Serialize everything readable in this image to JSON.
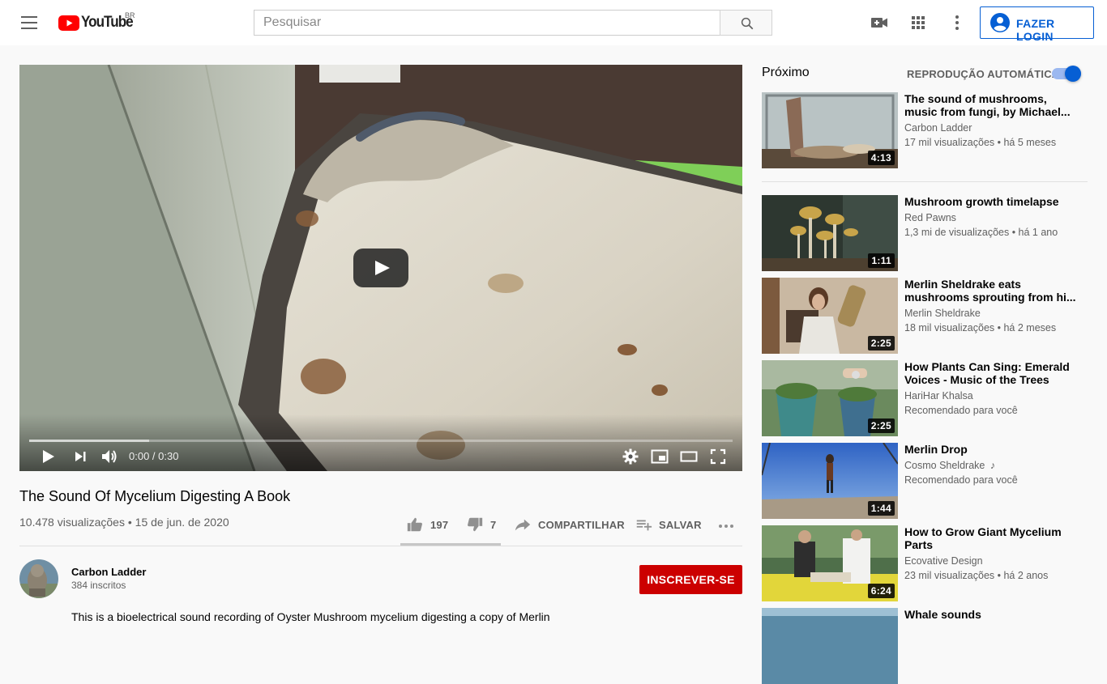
{
  "header": {
    "logo_text": "YouTube",
    "country": "BR",
    "search_placeholder": "Pesquisar",
    "login_label": "FAZER LOGIN",
    "colors": {
      "brand_red": "#ff0000",
      "accent_blue": "#065fd4"
    }
  },
  "player": {
    "time": "0:00 / 0:30",
    "progress_fraction": 0,
    "buffered_fraction": 0.17
  },
  "video": {
    "title": "The Sound Of Mycelium Digesting A Book",
    "views_date": "10.478 visualizações • 15 de jun. de 2020",
    "likes": "197",
    "dislikes": "7",
    "share_label": "COMPARTILHAR",
    "save_label": "SALVAR",
    "description_start": "This is a bioelectrical sound recording of Oyster Mushroom mycelium digesting a copy of Merlin"
  },
  "channel": {
    "name": "Carbon Ladder",
    "subscribers": "384 inscritos",
    "subscribe_label": "INSCREVER-SE"
  },
  "sidebar": {
    "next_label": "Próximo",
    "autoplay_label": "REPRODUÇÃO AUTOMÁTICA",
    "autoplay_on": true,
    "items": [
      {
        "title_line1": "The sound of mushrooms,",
        "title_line2": "music from fungi, by Michael...",
        "channel": "Carbon Ladder",
        "meta": "17 mil visualizações • há 5 meses",
        "duration": "4:13"
      },
      {
        "title_line1": "Mushroom growth timelapse",
        "title_line2": "",
        "channel": "Red Pawns",
        "meta": "1,3 mi de visualizações • há 1 ano",
        "duration": "1:11"
      },
      {
        "title_line1": "Merlin Sheldrake eats",
        "title_line2": "mushrooms sprouting from hi...",
        "channel": "Merlin Sheldrake",
        "meta": "18 mil visualizações • há 2 meses",
        "duration": "2:25"
      },
      {
        "title_line1": "How Plants Can Sing: Emerald",
        "title_line2": "Voices - Music of the Trees",
        "channel": "HariHar Khalsa",
        "meta": "Recomendado para você",
        "duration": "2:25"
      },
      {
        "title_line1": "Merlin Drop",
        "title_line2": "",
        "channel": "Cosmo Sheldrake",
        "channel_suffix": "♪",
        "meta": "Recomendado para você",
        "duration": "1:44"
      },
      {
        "title_line1": "How to Grow Giant Mycelium",
        "title_line2": "Parts",
        "channel": "Ecovative Design",
        "meta": "23 mil visualizações • há 2 anos",
        "duration": "6:24"
      },
      {
        "title_line1": "Whale sounds",
        "title_line2": "",
        "channel": "",
        "meta": "",
        "duration": ""
      }
    ]
  }
}
